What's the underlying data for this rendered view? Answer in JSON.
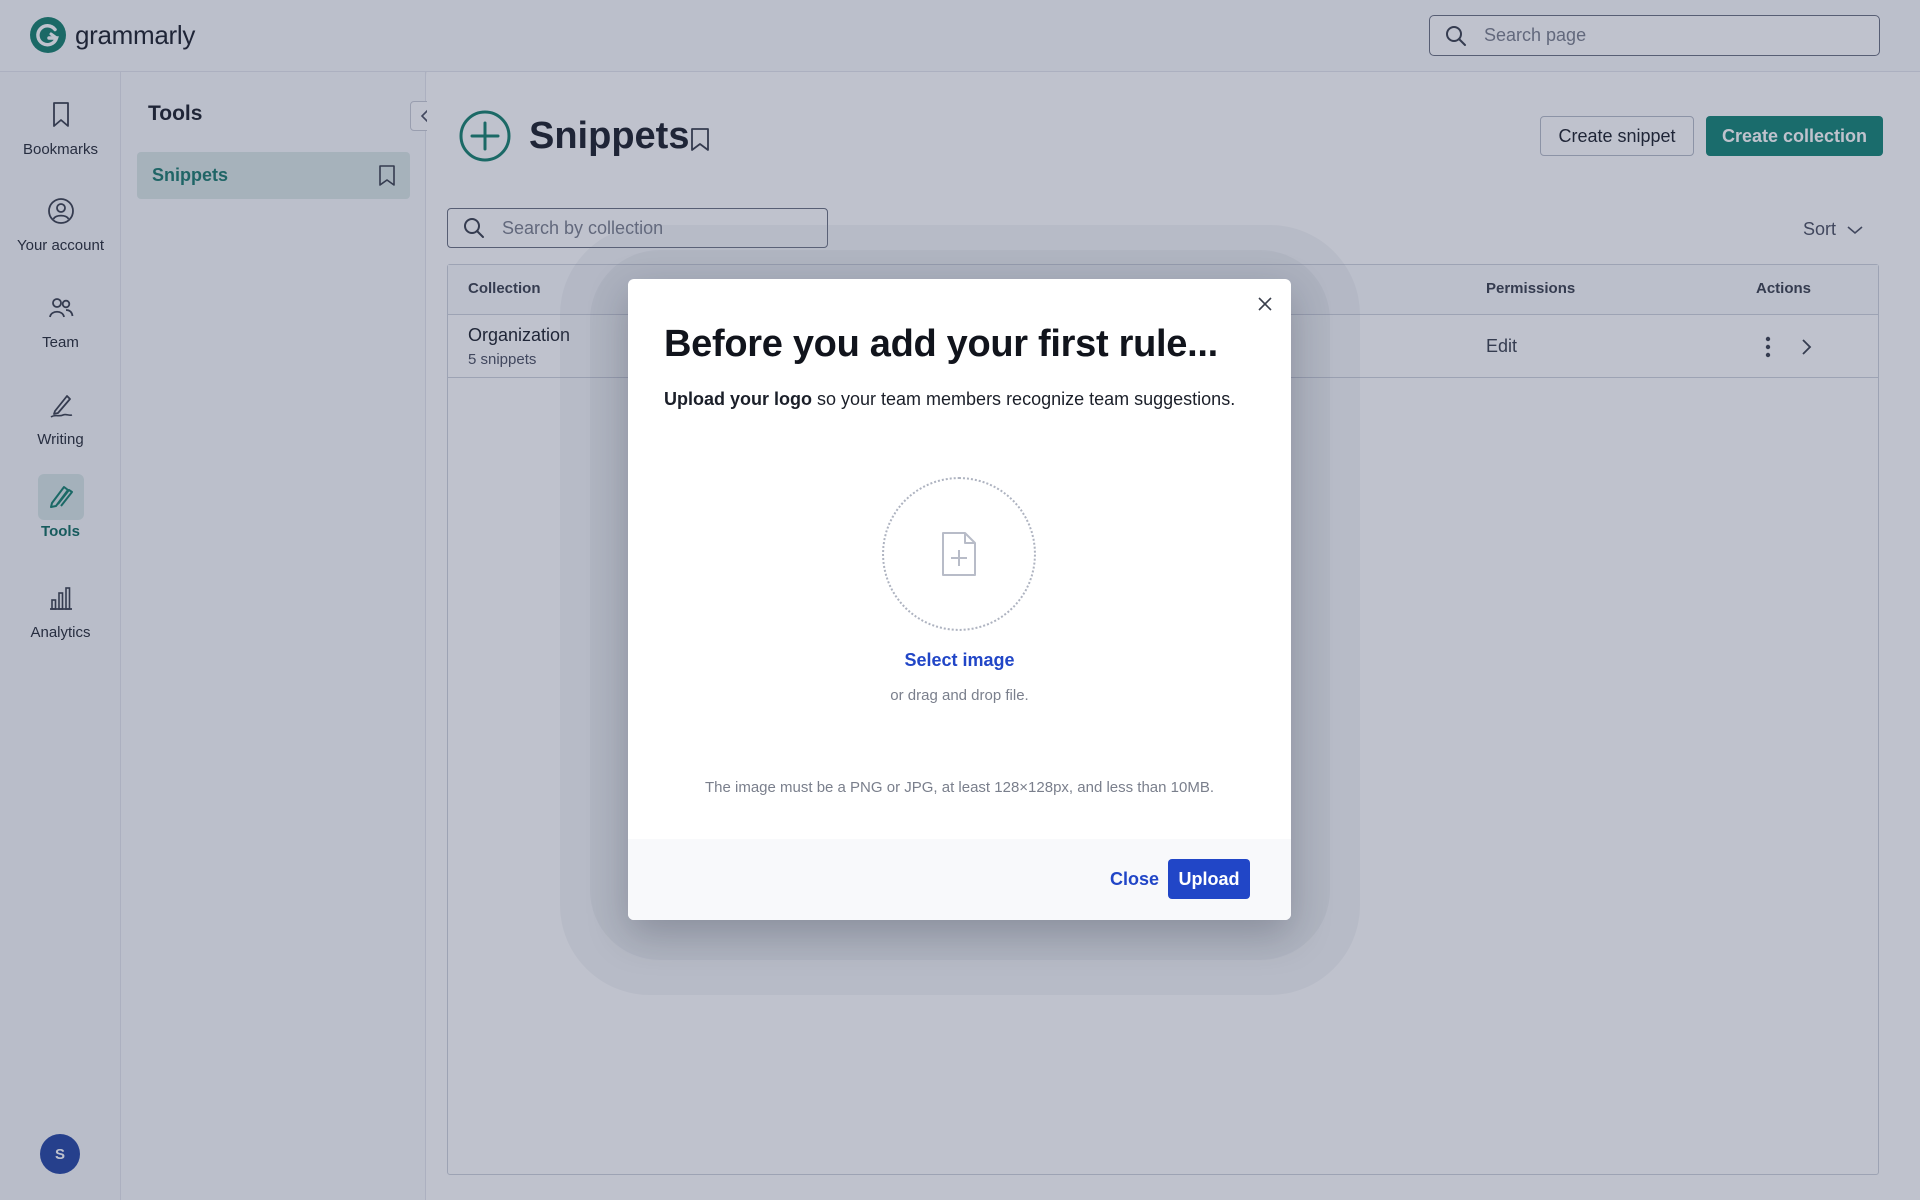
{
  "brand": {
    "name": "grammarly",
    "accent": "#15806c",
    "link_color": "#2146c7"
  },
  "header": {
    "search_placeholder": "Search page"
  },
  "rail": {
    "items": [
      {
        "label": "Bookmarks",
        "icon": "bookmark-icon"
      },
      {
        "label": "Your account",
        "icon": "account-icon"
      },
      {
        "label": "Team",
        "icon": "team-icon"
      },
      {
        "label": "Writing",
        "icon": "pen-icon"
      },
      {
        "label": "Tools",
        "icon": "tools-icon",
        "active": true
      },
      {
        "label": "Analytics",
        "icon": "chart-icon"
      }
    ],
    "avatar_initial": "S"
  },
  "tools_panel": {
    "title": "Tools",
    "items": [
      {
        "label": "Snippets",
        "active": true
      }
    ]
  },
  "main": {
    "title": "Snippets",
    "create_snippet_label": "Create snippet",
    "create_collection_label": "Create collection",
    "search_placeholder": "Search by collection",
    "sort_label": "Sort",
    "table": {
      "columns": {
        "collection": "Collection",
        "permissions": "Permissions",
        "actions": "Actions"
      },
      "rows": [
        {
          "name": "Organization",
          "sub": "5 snippets",
          "permission": "Edit"
        }
      ]
    }
  },
  "modal": {
    "title": "Before you add your first rule...",
    "desc_bold": "Upload your logo",
    "desc_rest": " so your team members recognize team suggestions.",
    "select_image": "Select image",
    "drag_text": "or drag and drop file.",
    "requirements": "The image must be a PNG or JPG, at least 128×128px, and less than 10MB.",
    "close_label": "Close",
    "upload_label": "Upload"
  }
}
